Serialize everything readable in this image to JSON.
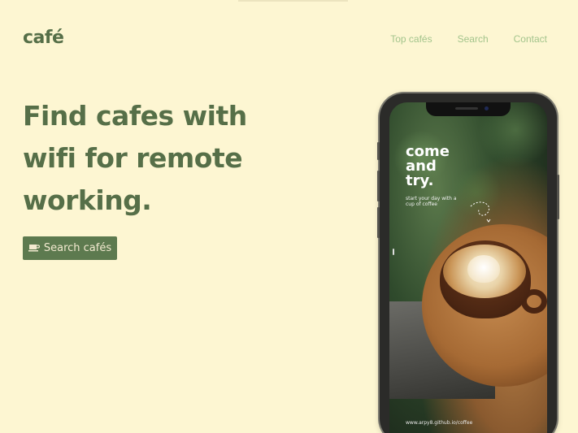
{
  "brand": {
    "logo": "café"
  },
  "nav": {
    "items": [
      {
        "label": "Top cafés"
      },
      {
        "label": "Search"
      },
      {
        "label": "Contact"
      }
    ]
  },
  "hero": {
    "headline_lines": [
      "Find cafes with",
      "wifi for remote",
      "working."
    ],
    "cta_label": "Search cafés",
    "cta_icon": "coffee-cup-icon"
  },
  "phone_screen": {
    "title_lines": [
      "come",
      "and",
      "try."
    ],
    "subtitle_lines": [
      "start your day with a",
      "cup of coffee"
    ],
    "url": "www.arpy8.github.io/coffee"
  },
  "colors": {
    "background": "#fdf6d2",
    "brand_green": "#566f48",
    "nav_link": "#a3c48c",
    "button_bg": "#5d7a4f",
    "button_text": "#f3ead0"
  }
}
